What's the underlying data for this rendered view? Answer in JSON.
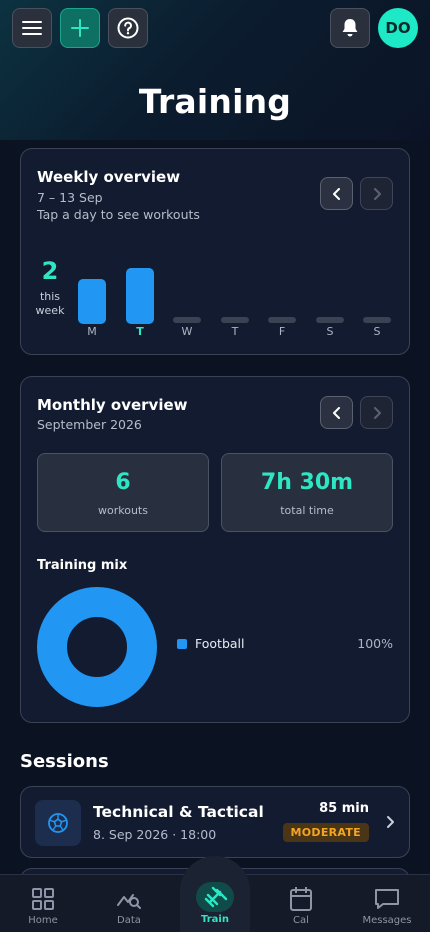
{
  "header": {
    "title": "Training",
    "avatar_initials": "DO",
    "accent": "#2ee6c4"
  },
  "weekly": {
    "title": "Weekly overview",
    "range": "7 – 13 Sep",
    "hint": "Tap a day to see workouts",
    "count": "2",
    "count_label_1": "this",
    "count_label_2": "week",
    "days": [
      {
        "label": "M",
        "level": 0.8,
        "today": false
      },
      {
        "label": "T",
        "level": 1.0,
        "today": true
      },
      {
        "label": "W",
        "level": 0,
        "today": false
      },
      {
        "label": "T",
        "level": 0,
        "today": false
      },
      {
        "label": "F",
        "level": 0,
        "today": false
      },
      {
        "label": "S",
        "level": 0,
        "today": false
      },
      {
        "label": "S",
        "level": 0,
        "today": false
      }
    ]
  },
  "monthly": {
    "title": "Monthly overview",
    "month": "September 2026",
    "workouts_value": "6",
    "workouts_label": "workouts",
    "time_value": "7h 30m",
    "time_label": "total time",
    "mix_title": "Training mix",
    "mix": [
      {
        "name": "Football",
        "percent": "100%",
        "color": "#2196f3"
      }
    ]
  },
  "sessions": {
    "title": "Sessions",
    "items": [
      {
        "name": "Technical & Tactical",
        "date": "8. Sep 2026 · 18:00",
        "duration": "85 min",
        "intensity": "MODERATE",
        "icon": "football-icon"
      }
    ]
  },
  "bottom_nav": {
    "tabs": [
      {
        "label": "Home",
        "icon": "grid-icon"
      },
      {
        "label": "Data",
        "icon": "chart-search-icon"
      },
      {
        "label": "Train",
        "icon": "dumbbell-icon",
        "active": true
      },
      {
        "label": "Cal",
        "icon": "calendar-icon"
      },
      {
        "label": "Messages",
        "icon": "message-icon"
      }
    ]
  }
}
